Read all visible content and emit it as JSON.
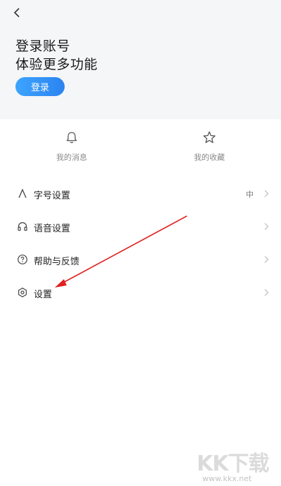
{
  "header": {
    "back_icon": "chevron-left-icon",
    "title_line1": "登录账号",
    "title_line2": "体验更多功能",
    "login_label": "登录",
    "background": "#f5f6f8",
    "accent": "#2b8af5"
  },
  "quick_actions": [
    {
      "label": "我的消息",
      "icon": "bell-icon"
    },
    {
      "label": "我的收藏",
      "icon": "star-icon"
    }
  ],
  "menu": [
    {
      "label": "字号设置",
      "icon": "font-size-icon",
      "value": "中"
    },
    {
      "label": "语音设置",
      "icon": "headphones-icon",
      "value": ""
    },
    {
      "label": "帮助与反馈",
      "icon": "help-icon",
      "value": ""
    },
    {
      "label": "设置",
      "icon": "settings-icon",
      "value": ""
    }
  ],
  "annotation": {
    "color": "#e02020"
  },
  "watermark": {
    "logo_text": "KK下载",
    "url": "www.kkx.net"
  }
}
